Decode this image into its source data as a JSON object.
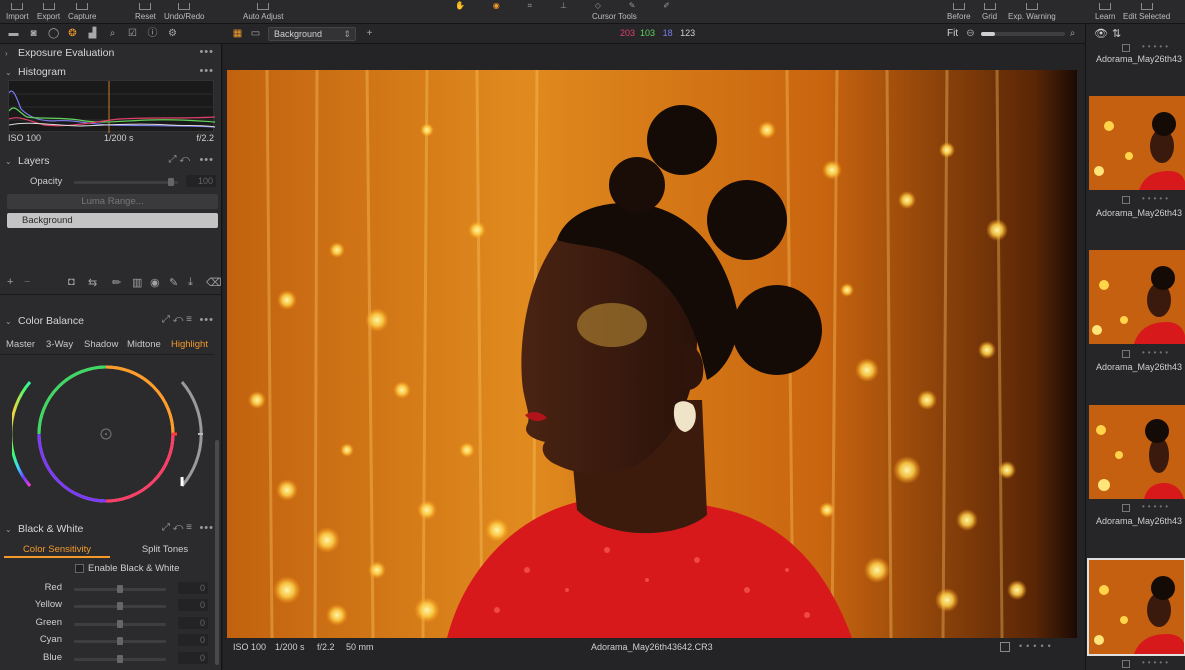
{
  "toolbar": {
    "left_items": [
      "Import",
      "Export",
      "Capture"
    ],
    "mid_items": [
      "Reset",
      "Undo/Redo",
      "Auto Adjust"
    ],
    "cursor_tools_label": "Cursor Tools",
    "right_items": [
      "Before",
      "Grid",
      "Exp. Warning",
      "Learn",
      "Edit Selected"
    ]
  },
  "row2": {
    "variant_select": "Background",
    "readout": {
      "r": "203",
      "g": "103",
      "b": "18",
      "l": "123"
    },
    "fit_label": "Fit"
  },
  "panels": {
    "exposure_evaluation": "Exposure Evaluation",
    "histogram": {
      "title": "Histogram",
      "iso": "ISO 100",
      "shutter": "1/200 s",
      "aperture": "f/2.2"
    },
    "layers": {
      "title": "Layers",
      "opacity_label": "Opacity",
      "opacity_value": "100",
      "luma_range": "Luma Range...",
      "layer_name": "Background"
    },
    "color_balance": {
      "title": "Color Balance",
      "tabs": [
        "Master",
        "3-Way",
        "Shadow",
        "Midtone",
        "Highlight"
      ],
      "active_tab": "Highlight"
    },
    "black_white": {
      "title": "Black & White",
      "tabs": [
        "Color Sensitivity",
        "Split Tones"
      ],
      "enable_label": "Enable Black & White",
      "sliders": [
        {
          "label": "Red",
          "value": "0"
        },
        {
          "label": "Yellow",
          "value": "0"
        },
        {
          "label": "Green",
          "value": "0"
        },
        {
          "label": "Cyan",
          "value": "0"
        },
        {
          "label": "Blue",
          "value": "0"
        }
      ]
    }
  },
  "viewer": {
    "iso": "ISO 100",
    "shutter": "1/200 s",
    "aperture": "f/2.2",
    "focal": "50 mm",
    "filename": "Adorama_May26th43642.CR3"
  },
  "filmstrip": {
    "captions": [
      "Adorama_May26th43",
      "Adorama_May26th43",
      "Adorama_May26th43",
      "Adorama_May26th43"
    ]
  },
  "colors": {
    "accent": "#f39a2b",
    "readout_r": "#e0406a",
    "readout_g": "#5fd35a",
    "readout_b": "#7b7bf0"
  }
}
